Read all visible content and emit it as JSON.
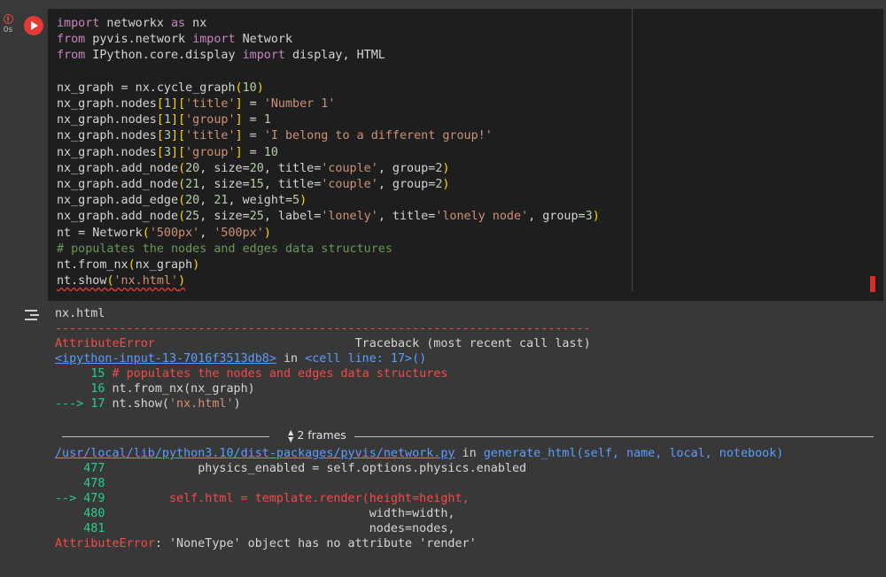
{
  "cell": {
    "exec_time": "0s",
    "code_lines": [
      "import networkx as nx",
      "from pyvis.network import Network",
      "from IPython.core.display import display, HTML",
      "",
      "nx_graph = nx.cycle_graph(10)",
      "nx_graph.nodes[1]['title'] = 'Number 1'",
      "nx_graph.nodes[1]['group'] = 1",
      "nx_graph.nodes[3]['title'] = 'I belong to a different group!'",
      "nx_graph.nodes[3]['group'] = 10",
      "nx_graph.add_node(20, size=20, title='couple', group=2)",
      "nx_graph.add_node(21, size=15, title='couple', group=2)",
      "nx_graph.add_edge(20, 21, weight=5)",
      "nx_graph.add_node(25, size=25, label='lonely', title='lonely node', group=3)",
      "nt = Network('500px', '500px')",
      "# populates the nodes and edges data structures",
      "nt.from_nx(nx_graph)",
      "nt.show('nx.html')"
    ]
  },
  "output": {
    "stdout": "nx.html",
    "dashes": "---------------------------------------------------------------------------",
    "error_name": "AttributeError",
    "traceback_header": "Traceback (most recent call last)",
    "input_link": "<ipython-input-13-7016f3513db8>",
    "input_in": " in ",
    "input_cell": "<cell line: 17>()",
    "tb1": [
      {
        "arrow": "     ",
        "num": "15",
        "code": " # populates the nodes and edges data structures"
      },
      {
        "arrow": "     ",
        "num": "16",
        "code": " nt.from_nx(nx_graph)"
      },
      {
        "arrow": "---> ",
        "num": "17",
        "code": " nt.show('nx.html')"
      }
    ],
    "frames_label": "2 frames",
    "file_link": "/usr/local/lib/python3.10/dist-packages/pyvis/network.py",
    "file_in": " in ",
    "file_func": "generate_html(self, name, local, notebook)",
    "tb2": [
      {
        "arrow": "    ",
        "num": "477",
        "code": "             physics_enabled = self.options.physics.enabled"
      },
      {
        "arrow": "    ",
        "num": "478",
        "code": ""
      },
      {
        "arrow": "--> ",
        "num": "479",
        "code": "         self.html = template.render(height=height,"
      },
      {
        "arrow": "    ",
        "num": "480",
        "code": "                                     width=width,"
      },
      {
        "arrow": "    ",
        "num": "481",
        "code": "                                     nodes=nodes,"
      }
    ],
    "final_error_name": "AttributeError",
    "final_error_msg": ": 'NoneType' object has no attribute 'render'"
  },
  "colors": {
    "keyword": "#c586c0",
    "string": "#ce9178",
    "number": "#b5cea8",
    "comment": "#6a9955",
    "error": "#f14c4c",
    "link": "#5c9cff",
    "lineno": "#23d18b"
  },
  "icons": {
    "status": "error-circle-icon",
    "run": "run-cell-icon",
    "output_menu": "output-actions-icon",
    "frames": "chevron-updown-icon"
  }
}
